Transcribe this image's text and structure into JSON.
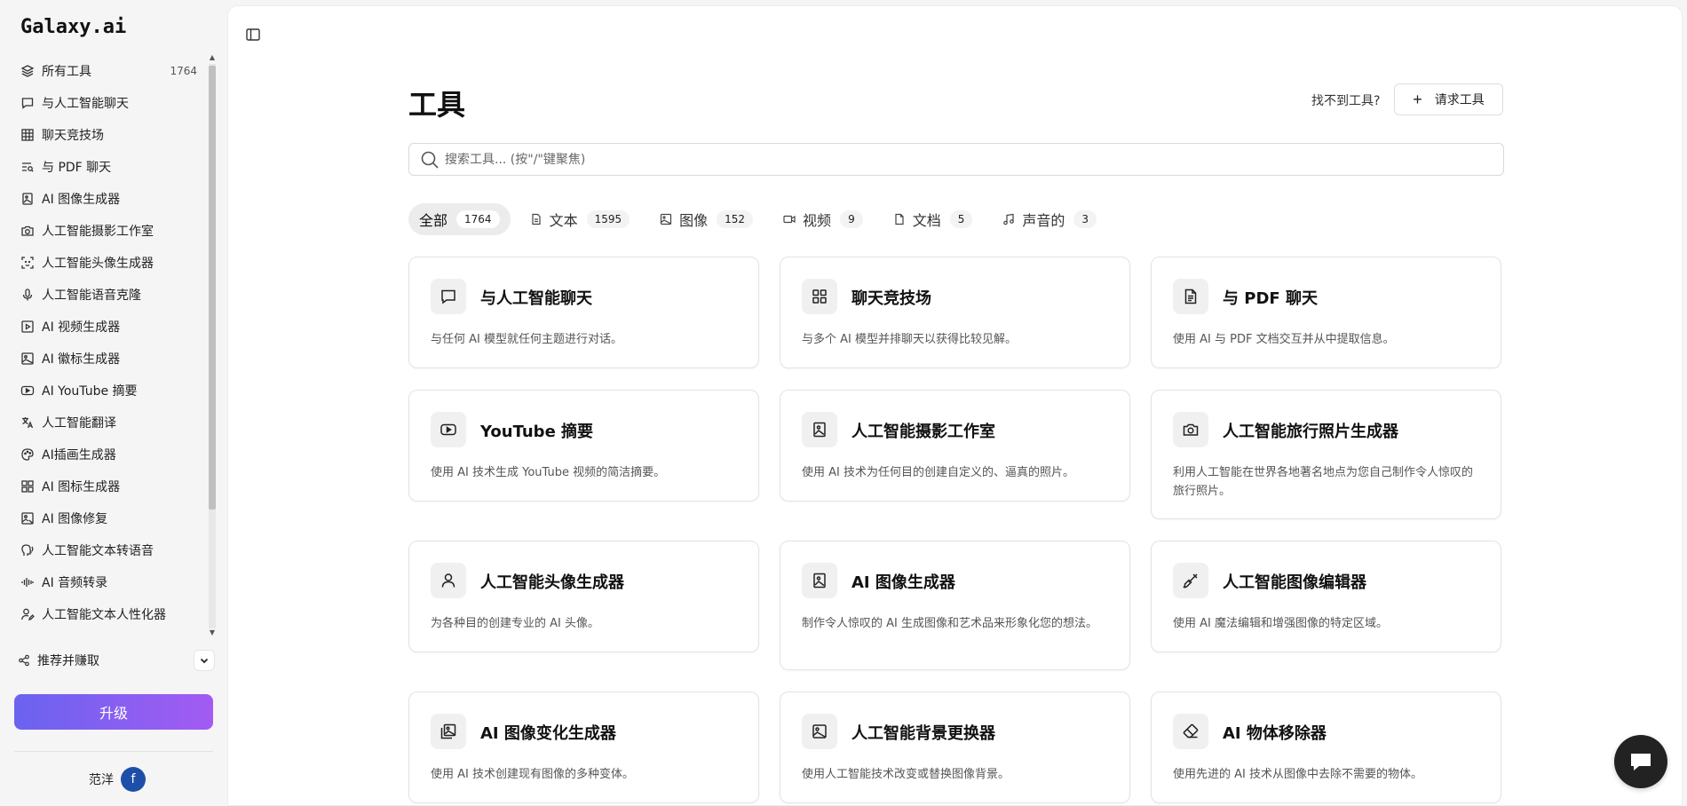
{
  "app": {
    "logo": "Galaxy.ai"
  },
  "sidebar": {
    "items": [
      {
        "label": "所有工具",
        "count": "1764",
        "icon": "layers-icon"
      },
      {
        "label": "与人工智能聊天",
        "icon": "chat-bubble-icon"
      },
      {
        "label": "聊天竞技场",
        "icon": "grid-icon"
      },
      {
        "label": "与 PDF 聊天",
        "icon": "text-search-icon"
      },
      {
        "label": "AI 图像生成器",
        "icon": "image-file-icon"
      },
      {
        "label": "人工智能摄影工作室",
        "icon": "camera-icon"
      },
      {
        "label": "人工智能头像生成器",
        "icon": "face-scan-icon"
      },
      {
        "label": "人工智能语音克隆",
        "icon": "microphone-icon"
      },
      {
        "label": "AI 视频生成器",
        "icon": "video-file-icon"
      },
      {
        "label": "AI 徽标生成器",
        "icon": "image-icon"
      },
      {
        "label": "AI YouTube 摘要",
        "icon": "youtube-icon"
      },
      {
        "label": "人工智能翻译",
        "icon": "translate-icon"
      },
      {
        "label": "AI插画生成器",
        "icon": "palette-icon"
      },
      {
        "label": "AI 图标生成器",
        "icon": "apps-icon"
      },
      {
        "label": "AI 图像修复",
        "icon": "image-repair-icon"
      },
      {
        "label": "人工智能文本转语音",
        "icon": "speech-icon"
      },
      {
        "label": "AI 音频转录",
        "icon": "audio-wave-icon"
      },
      {
        "label": "人工智能文本人性化器",
        "icon": "user-edit-icon"
      }
    ],
    "referral": "推荐并赚取",
    "upgrade": "升级",
    "user_name": "范洋",
    "user_initial": "f"
  },
  "header": {
    "title": "工具",
    "not_found": "找不到工具?",
    "request_button": "请求工具"
  },
  "search": {
    "placeholder": "搜索工具... (按\"/\"键聚焦)"
  },
  "tabs": [
    {
      "label": "全部",
      "count": "1764"
    },
    {
      "label": "文本",
      "count": "1595"
    },
    {
      "label": "图像",
      "count": "152"
    },
    {
      "label": "视频",
      "count": "9"
    },
    {
      "label": "文档",
      "count": "5"
    },
    {
      "label": "声音的",
      "count": "3"
    }
  ],
  "cards": [
    {
      "title": "与人工智能聊天",
      "desc": "与任何 AI 模型就任何主题进行对话。",
      "icon": "chat-bubble-icon"
    },
    {
      "title": "聊天竞技场",
      "desc": "与多个 AI 模型并排聊天以获得比较见解。",
      "icon": "grid-icon"
    },
    {
      "title": "与 PDF 聊天",
      "desc": "使用 AI 与 PDF 文档交互并从中提取信息。",
      "icon": "document-icon"
    },
    {
      "title": "YouTube 摘要",
      "desc": "使用 AI 技术生成 YouTube 视频的简洁摘要。",
      "icon": "youtube-icon"
    },
    {
      "title": "人工智能摄影工作室",
      "desc": "使用 AI 技术为任何目的创建自定义的、逼真的照片。",
      "icon": "image-file-icon"
    },
    {
      "title": "人工智能旅行照片生成器",
      "desc": "利用人工智能在世界各地著名地点为您自己制作令人惊叹的旅行照片。",
      "icon": "camera-icon"
    },
    {
      "title": "人工智能头像生成器",
      "desc": "为各种目的创建专业的 AI 头像。",
      "icon": "user-icon"
    },
    {
      "title": "AI 图像生成器",
      "desc": "制作令人惊叹的 AI 生成图像和艺术品来形象化您的想法。",
      "icon": "image-file-icon"
    },
    {
      "title": "人工智能图像编辑器",
      "desc": "使用 AI 魔法编辑和增强图像的特定区域。",
      "icon": "brush-icon"
    },
    {
      "title": "AI 图像变化生成器",
      "desc": "使用 AI 技术创建现有图像的多种变体。",
      "icon": "images-icon"
    },
    {
      "title": "人工智能背景更换器",
      "desc": "使用人工智能技术改变或替换图像背景。",
      "icon": "image-icon"
    },
    {
      "title": "AI 物体移除器",
      "desc": "使用先进的 AI 技术从图像中去除不需要的物体。",
      "icon": "eraser-icon"
    }
  ],
  "colors": {
    "upgrade_start": "#6a63f0",
    "upgrade_end": "#a35bf2",
    "avatar": "#1e4fa8"
  }
}
